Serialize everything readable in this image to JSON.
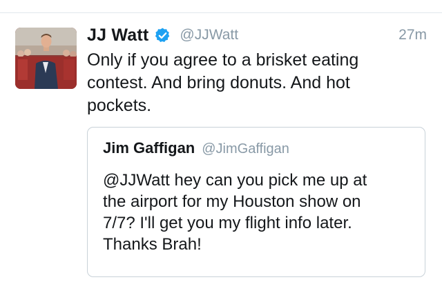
{
  "tweet": {
    "display_name": "JJ Watt",
    "handle": "@JJWatt",
    "timestamp": "27m",
    "verified": true,
    "avatar_icon": "user-photo-avatar",
    "text_lines": [
      "Only if you agree to a brisket eating",
      "contest. And bring donuts. And hot",
      "pockets."
    ]
  },
  "quoted_tweet": {
    "display_name": "Jim Gaffigan",
    "handle": "@JimGaffigan",
    "text_lines": [
      "@JJWatt hey can you pick me up at",
      "the airport for my Houston show on",
      "7/7?  I'll get you my flight info later.",
      "Thanks Brah!"
    ]
  },
  "colors": {
    "verified_badge": "#1da1f2",
    "secondary_text": "#8899a6",
    "primary_text": "#14171a",
    "card_border": "#c8d1d8"
  }
}
